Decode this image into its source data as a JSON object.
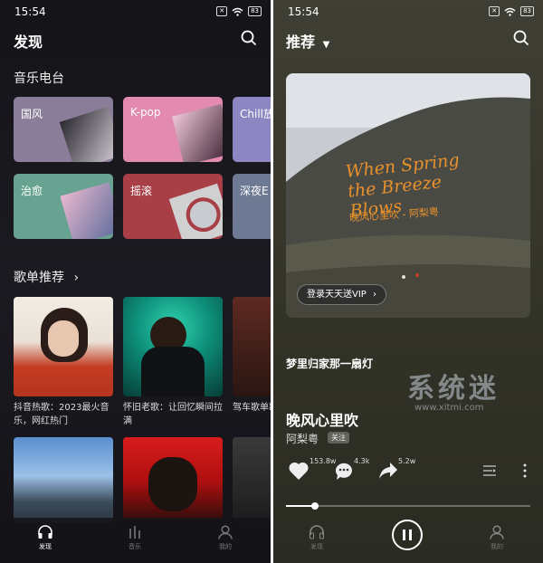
{
  "left": {
    "status_time": "15:54",
    "battery": "83",
    "title": "发现",
    "radio_heading": "音乐电台",
    "radio_cards": [
      {
        "label": "国风",
        "bg": "#8a7d99"
      },
      {
        "label": "K-pop",
        "bg": "#e28ab0"
      },
      {
        "label": "Chill放",
        "bg": "#8c87c2"
      },
      {
        "label": "治愈",
        "bg": "#68a392"
      },
      {
        "label": "摇滚",
        "bg": "#a83f47"
      },
      {
        "label": "深夜E",
        "bg": "#6e7a94"
      }
    ],
    "playlist_heading": "歌单推荐",
    "playlists": [
      {
        "caption": "抖音热歌：2023最火音乐，网红热门"
      },
      {
        "caption": "怀旧老歌：让回忆瞬间拉满"
      },
      {
        "caption": "驾车歌单歌单就够"
      }
    ],
    "nav": [
      {
        "label": "发现",
        "icon": "headphones-icon"
      },
      {
        "label": "音乐",
        "icon": "equalizer-icon"
      },
      {
        "label": "我的",
        "icon": "profile-icon"
      }
    ]
  },
  "right": {
    "status_time": "15:54",
    "battery": "83",
    "title": "推荐",
    "album_text_en": "When Spring the Breeze Blows",
    "album_text_cn": "晚风心里吹 - 阿梨粤",
    "vip_label": "登录天天送VIP",
    "lyric": "梦里归家那一扇灯",
    "watermark_cn": "系统迷",
    "watermark_url": "www.xitmi.com",
    "song_title": "晚风心里吹",
    "artist": "阿梨粤",
    "follow_label": "关注",
    "likes": "153.8w",
    "comments": "4.3k",
    "shares": "5.2w",
    "progress": 0.12,
    "nav": [
      {
        "label": "发现",
        "icon": "headphones-icon"
      },
      {
        "label": "我的",
        "icon": "profile-icon"
      }
    ]
  }
}
